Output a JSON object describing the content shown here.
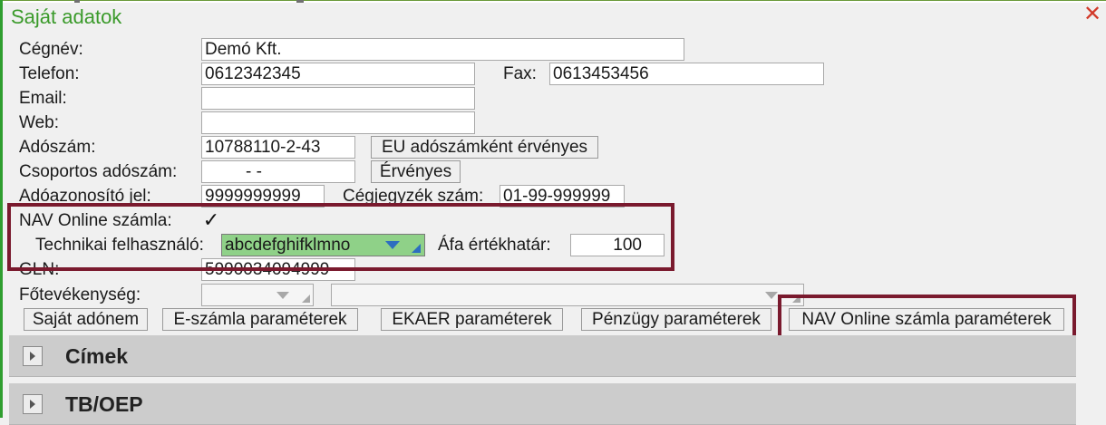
{
  "window": {
    "title": "Saját adatok",
    "close_glyph": "✕"
  },
  "form": {
    "company_name": {
      "label": "Cégnév:",
      "value": "Demó Kft."
    },
    "phone": {
      "label": "Telefon:",
      "value": "0612342345"
    },
    "fax": {
      "label": "Fax:",
      "value": "0613453456"
    },
    "email": {
      "label": "Email:",
      "value": ""
    },
    "web": {
      "label": "Web:",
      "value": ""
    },
    "tax_number": {
      "label": "Adószám:",
      "value": "10788110-2-43",
      "button": "EU adószámként érvényes"
    },
    "group_tax_number": {
      "label": "Csoportos adószám:",
      "value": "- -",
      "button": "Érvényes"
    },
    "tax_id": {
      "label": "Adóazonosító jel:",
      "value": "9999999999"
    },
    "company_reg": {
      "label": "Cégjegyzék szám:",
      "value": "01-99-999999"
    },
    "nav_online": {
      "label": "NAV Online számla:",
      "checked": true,
      "check_glyph": "✓"
    },
    "technical_user": {
      "label": "Technikai felhasználó:",
      "value": "abcdefghifklmno"
    },
    "vat_threshold": {
      "label": "Áfa értékhatár:",
      "value": "100"
    },
    "gln": {
      "label": "GLN:",
      "value": "5990034094999"
    },
    "main_activity": {
      "label": "Főtevékenység:",
      "code": "",
      "description": ""
    }
  },
  "buttons": {
    "own_tax": "Saját adónem",
    "einvoice": "E-számla paraméterek",
    "ekaer": "EKAER paraméterek",
    "finance": "Pénzügy paraméterek",
    "nav_params": "NAV Online számla paraméterek"
  },
  "sections": [
    {
      "title": "Címek"
    },
    {
      "title": "TB/OEP"
    }
  ],
  "colors": {
    "title": "#3a9a2a",
    "highlight_border": "#7a1a2e",
    "selected_field": "#8fd188",
    "combo_arrow": "#2d6ec0",
    "close": "#d23a2a"
  },
  "icons": {
    "close": "close-icon",
    "dropdown": "chevron-down-icon",
    "expander": "chevron-right-icon",
    "check": "check-icon"
  }
}
